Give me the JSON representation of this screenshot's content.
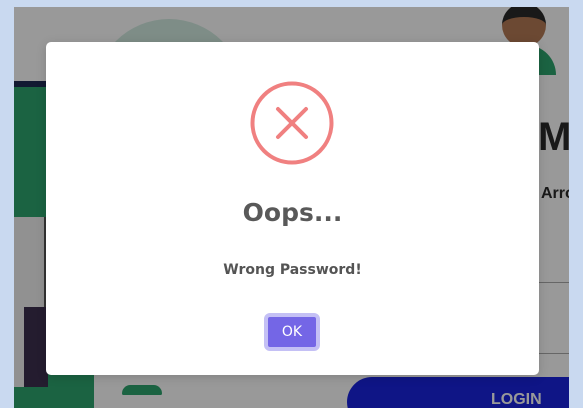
{
  "background": {
    "title_fragment": "M",
    "subtitle_fragment": "Arro",
    "login_label": "LOGIN"
  },
  "modal": {
    "icon": "error-x-icon",
    "title": "Oops...",
    "message": "Wrong Password!",
    "ok_label": "OK"
  },
  "colors": {
    "error_icon": "#f08080",
    "ok_button": "#7466e6",
    "login_button": "#1a23e0",
    "accent_green": "#2ea56e"
  }
}
